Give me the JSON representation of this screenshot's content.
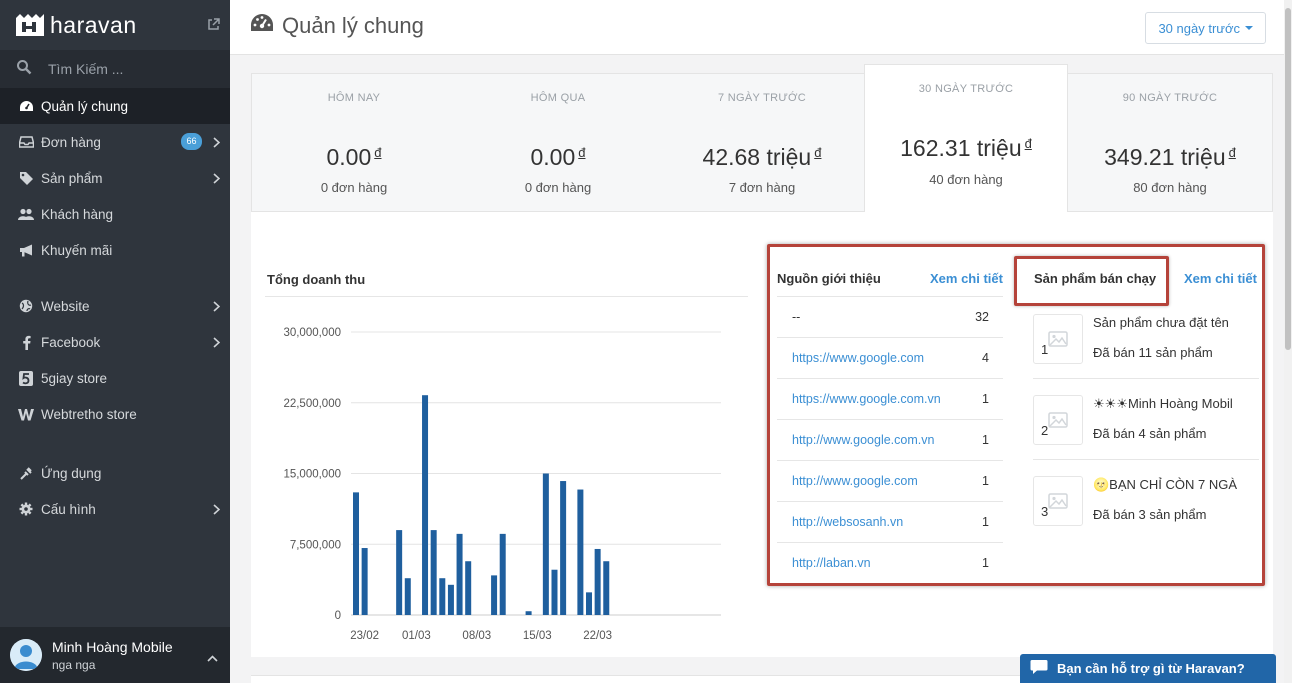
{
  "brand": {
    "name": "haravan"
  },
  "search": {
    "placeholder": "Tìm Kiếm ..."
  },
  "sidebar": {
    "items": [
      {
        "label": "Quản lý chung",
        "icon": "dashboard-icon"
      },
      {
        "label": "Đơn hàng",
        "icon": "inbox-icon",
        "badge": "66"
      },
      {
        "label": "Sản phẩm",
        "icon": "tags-icon"
      },
      {
        "label": "Khách hàng",
        "icon": "users-icon"
      },
      {
        "label": "Khuyến mãi",
        "icon": "bullhorn-icon"
      },
      {
        "label": "Website",
        "icon": "globe-icon"
      },
      {
        "label": "Facebook",
        "icon": "facebook-icon"
      },
      {
        "label": "5giay store",
        "icon": "5giay-icon"
      },
      {
        "label": "Webtretho store",
        "icon": "webtretho-icon"
      },
      {
        "label": "Ứng dụng",
        "icon": "apps-icon"
      },
      {
        "label": "Cấu hình",
        "icon": "gear-icon"
      }
    ]
  },
  "user": {
    "name": "Minh Hoàng Mobile",
    "sub": "nga nga"
  },
  "header": {
    "title": "Quản lý chung",
    "range": "30 ngày trước"
  },
  "stats": [
    {
      "label": "HÔM NAY",
      "value": "0.00",
      "currency": "đ",
      "orders": "0 đơn hàng"
    },
    {
      "label": "HÔM QUA",
      "value": "0.00",
      "currency": "đ",
      "orders": "0 đơn hàng"
    },
    {
      "label": "7 NGÀY TRƯỚC",
      "value": "42.68 triệu",
      "currency": "đ",
      "orders": "7 đơn hàng"
    },
    {
      "label": "30 NGÀY TRƯỚC",
      "value": "162.31 triệu",
      "currency": "đ",
      "orders": "40 đơn hàng"
    },
    {
      "label": "90 NGÀY TRƯỚC",
      "value": "349.21 triệu",
      "currency": "đ",
      "orders": "80 đơn hàng"
    }
  ],
  "revenue": {
    "title": "Tổng doanh thu"
  },
  "referrers": {
    "title": "Nguồn giới thiệu",
    "link": "Xem chi tiết",
    "rows": [
      {
        "source": "--",
        "count": "32"
      },
      {
        "source": "https://www.google.com",
        "count": "4"
      },
      {
        "source": "https://www.google.com.vn",
        "count": "1"
      },
      {
        "source": "http://www.google.com.vn",
        "count": "1"
      },
      {
        "source": "http://www.google.com",
        "count": "1"
      },
      {
        "source": "http://websosanh.vn",
        "count": "1"
      },
      {
        "source": "http://laban.vn",
        "count": "1"
      }
    ]
  },
  "top_products": {
    "title": "Sản phẩm bán chạy",
    "link": "Xem chi tiết",
    "items": [
      {
        "rank": "1",
        "name": "Sản phẩm chưa đặt tên",
        "sold": "Đã bán 11 sản phẩm"
      },
      {
        "rank": "2",
        "name": "☀☀☀Minh Hoàng Mobil",
        "sold": "Đã bán 4 sản phẩm"
      },
      {
        "rank": "3",
        "name": "🌝BẠN CHỈ CÒN 7 NGÀ",
        "sold": "Đã bán 3 sản phẩm"
      }
    ]
  },
  "support": {
    "label": "Bạn cần hỗ trợ gì từ Haravan?"
  },
  "colors": {
    "sidebar": "#2f353d",
    "accent": "#3b8fd4",
    "bar": "#1f5f9e",
    "highlight": "#b5433a"
  },
  "chart_data": {
    "type": "bar",
    "title": "Tổng doanh thu",
    "xlabel": "",
    "ylabel": "",
    "ylim": [
      0,
      30000000
    ],
    "yticks": [
      "30,000,000",
      "22,500,000",
      "15,000,000",
      "7,500,000",
      "0"
    ],
    "ytick_values": [
      30000000,
      22500000,
      15000000,
      7500000,
      0
    ],
    "xticks": [
      "23/02",
      "01/03",
      "08/03",
      "15/03",
      "22/03"
    ],
    "categories": [
      "22/02",
      "23/02",
      "24/02",
      "25/02",
      "26/02",
      "27/02",
      "28/02",
      "01/03",
      "02/03",
      "03/03",
      "04/03",
      "05/03",
      "06/03",
      "07/03",
      "08/03",
      "09/03",
      "10/03",
      "11/03",
      "12/03",
      "13/03",
      "14/03",
      "15/03",
      "16/03",
      "17/03",
      "18/03",
      "19/03",
      "20/03",
      "21/03",
      "22/03",
      "23/03"
    ],
    "values": [
      13000000,
      7100000,
      0,
      0,
      0,
      9000000,
      3900000,
      0,
      23300000,
      9000000,
      3900000,
      3200000,
      8600000,
      5700000,
      0,
      0,
      4200000,
      8600000,
      0,
      0,
      400000,
      0,
      15000000,
      4800000,
      14200000,
      0,
      13300000,
      2400000,
      7000000,
      5700000
    ]
  }
}
